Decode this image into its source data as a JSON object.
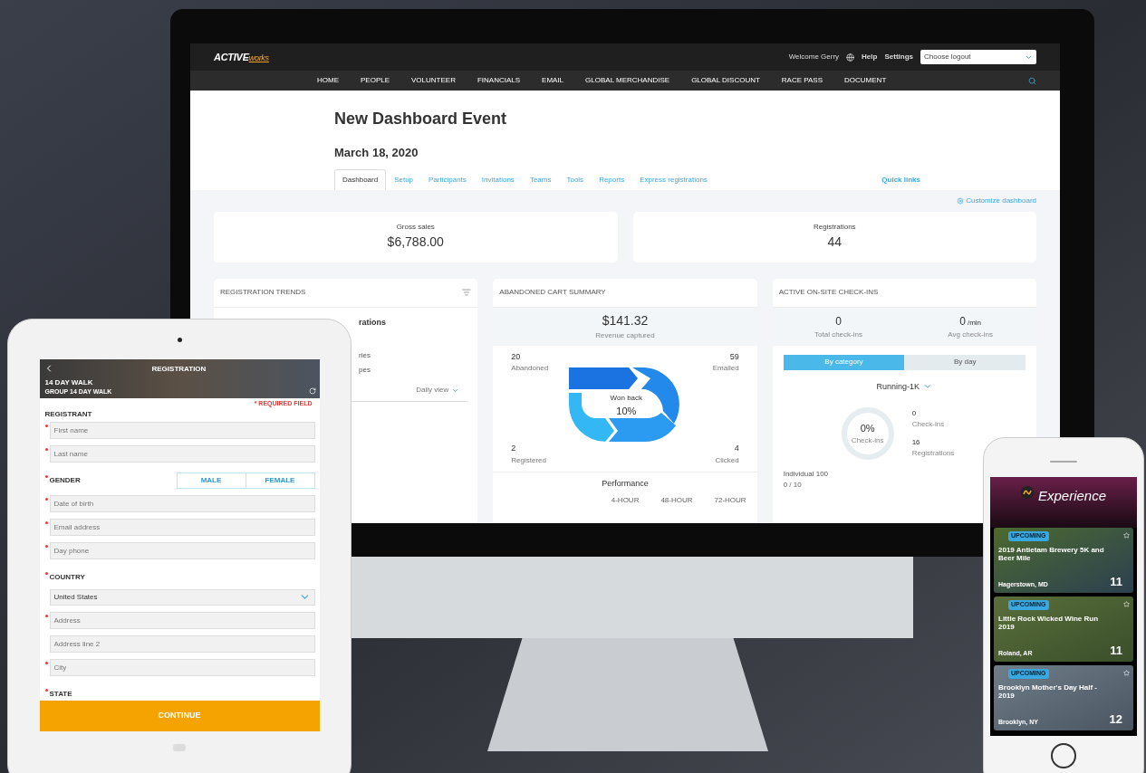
{
  "desktop": {
    "logo": {
      "brand": "ACTIVE",
      "suffix": "works"
    },
    "welcome": "Welcome Gerry",
    "help": "Help",
    "settings": "Settings",
    "logout_select": {
      "value": "Choose logout"
    },
    "nav": [
      "HOME",
      "PEOPLE",
      "VOLUNTEER",
      "FINANCIALS",
      "EMAIL",
      "GLOBAL MERCHANDISE",
      "GLOBAL DISCOUNT",
      "RACE PASS",
      "DOCUMENT"
    ],
    "title": "New Dashboard Event",
    "date": "March 18, 2020",
    "tabs": [
      {
        "label": "Dashboard",
        "selected": true
      },
      {
        "label": "Setup",
        "selected": false
      },
      {
        "label": "Participants",
        "selected": false
      },
      {
        "label": "Invitations",
        "selected": false
      },
      {
        "label": "Teams",
        "selected": false
      },
      {
        "label": "Tools",
        "selected": false
      },
      {
        "label": "Reports",
        "selected": false
      },
      {
        "label": "Express registrations",
        "selected": false
      }
    ],
    "quick_links": "Quick links",
    "customize": "Customize dashboard",
    "stats": [
      {
        "label": "Gross sales",
        "value": "$6,788.00"
      },
      {
        "label": "Registrations",
        "value": "44"
      }
    ],
    "registration_trends": {
      "title": "REGISTRATION TRENDS",
      "legend_title": "rations",
      "legend": [
        "ries",
        "pes"
      ],
      "view": "Daily view"
    },
    "abandoned_cart": {
      "title": "ABANDONED CART SUMMARY",
      "amount": "$141.32",
      "amount_label": "Revenue captured",
      "metrics": [
        {
          "value": "20",
          "label": "Abandoned"
        },
        {
          "value": "59",
          "label": "Emailed"
        },
        {
          "value": "2",
          "label": "Registered"
        },
        {
          "value": "4",
          "label": "Clicked"
        }
      ],
      "center_label": "Won back",
      "center_value": "10%",
      "performance": {
        "title": "Performance",
        "columns": [
          "4-HOUR",
          "48-HOUR",
          "72-HOUR"
        ]
      }
    },
    "checkins": {
      "title": "ACTIVE ON-SITE CHECK-INS",
      "stats": [
        {
          "value": "0",
          "label": "Total check-ins"
        },
        {
          "value": "0",
          "unit": "/min",
          "label": "Avg check-ins"
        }
      ],
      "toggle": [
        {
          "label": "By category",
          "selected": true
        },
        {
          "label": "By day",
          "selected": false
        }
      ],
      "category": "Running-1K",
      "ring": {
        "value": "0%",
        "label": "Check-ins",
        "level": 0
      },
      "side_stats": [
        {
          "value": "0",
          "label": "Check-ins"
        },
        {
          "value": "16",
          "label": "Registrations"
        }
      ],
      "individual": {
        "label": "Individual 100",
        "value": "0 / 10"
      }
    }
  },
  "tablet": {
    "header": {
      "title": "REGISTRATION",
      "event": "14 DAY WALK",
      "group": "GROUP 14 DAY WALK"
    },
    "required_note": "* REQUIRED FIELD",
    "section": "REGISTRANT",
    "fields": [
      {
        "kind": "input",
        "placeholder": "First name",
        "required": true
      },
      {
        "kind": "input",
        "placeholder": "Last name",
        "required": true
      },
      {
        "kind": "choice",
        "label": "GENDER",
        "required": true,
        "options": [
          {
            "label": "MALE",
            "selected": false
          },
          {
            "label": "FEMALE",
            "selected": false
          }
        ]
      },
      {
        "kind": "input",
        "placeholder": "Date of birth",
        "required": true
      },
      {
        "kind": "input",
        "placeholder": "Email address",
        "required": true
      },
      {
        "kind": "input",
        "placeholder": "Day phone",
        "required": true
      },
      {
        "kind": "label",
        "label": "COUNTRY",
        "required": true
      },
      {
        "kind": "select",
        "value": "United States"
      },
      {
        "kind": "input",
        "placeholder": "Address",
        "required": true
      },
      {
        "kind": "input",
        "placeholder": "Address line 2",
        "required": false
      },
      {
        "kind": "input",
        "placeholder": "City",
        "required": true
      },
      {
        "kind": "label",
        "label": "STATE",
        "required": true
      }
    ],
    "button": "CONTINUE"
  },
  "phone": {
    "app_title": "Experience",
    "events": [
      {
        "badge": "UPCOMING",
        "title": "2019 Antietam Brewery 5K and Beer Mile",
        "location": "Hagerstown, MD",
        "day": "11"
      },
      {
        "badge": "UPCOMING",
        "title": "Little Rock Wicked Wine Run 2019",
        "location": "Roland, AR",
        "day": "11"
      },
      {
        "badge": "UPCOMING",
        "title": "Brooklyn Mother's Day Half - 2019",
        "location": "Brooklyn, NY",
        "day": "12"
      }
    ]
  }
}
